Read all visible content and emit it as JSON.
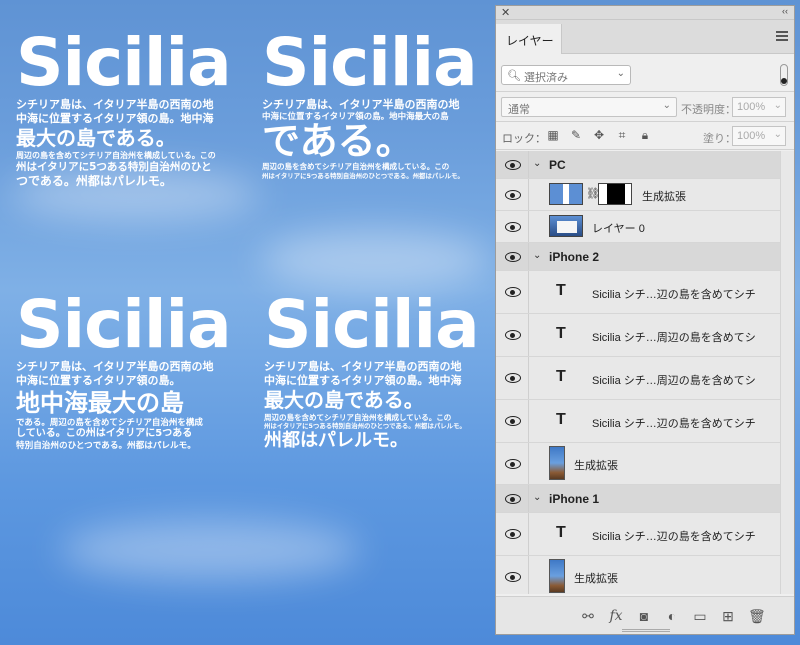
{
  "canvas": {
    "blocks": [
      {
        "title": "Sicilia",
        "lines": [
          "シチリア島は、イタリア半島の西南の地",
          "中海に位置するイタリア領の島。地中海",
          "最大の島である。",
          "周辺の島を含めてシチリア自治州を構成している。この",
          "州はイタリアに5つある特別自治州のひと",
          "つである。州都はパレルモ。"
        ]
      },
      {
        "title": "Sicilia",
        "lines": [
          "シチリア島は、イタリア半島の西南の地",
          "中海に位置するイタリア領の島。地中海最大の島",
          "である。",
          "周辺の島を含めてシチリア自治州を構成している。この",
          "州はイタリアに5つある特別自治州のひとつである。州都はパレルモ。"
        ]
      },
      {
        "title": "Sicilia",
        "lines": [
          "シチリア島は、イタリア半島の西南の地",
          "中海に位置するイタリア領の島。",
          "地中海最大の島",
          "である。周辺の島を含めてシチリア自治州を構成",
          "している。この州はイタリアに5つある",
          "特別自治州のひとつである。州都はパレルモ。"
        ]
      },
      {
        "title": "Sicilia",
        "lines": [
          "シチリア島は、イタリア半島の西南の地",
          "中海に位置するイタリア領の島。地中海",
          "最大の島である。",
          "周辺の島を含めてシチリア自治州を構成している。この",
          "州はイタリアに5つある特別自治州のひとつである。州都はパレルモ。",
          "州都はパレルモ。"
        ]
      }
    ]
  },
  "panel": {
    "tab_label": "レイヤー",
    "filter": {
      "value": "選択済み"
    },
    "blend_mode": "通常",
    "opacity_label": "不透明度：",
    "opacity_value": "100%",
    "lock_label": "ロック：",
    "fill_label": "塗り：",
    "fill_value": "100%",
    "rows": [
      {
        "kind": "group",
        "name": "PC"
      },
      {
        "kind": "smart",
        "name": "生成拡張"
      },
      {
        "kind": "image",
        "name": "レイヤー 0"
      },
      {
        "kind": "group",
        "name": "iPhone 2"
      },
      {
        "kind": "text",
        "name": "Sicilia シチ…辺の島を含めてシチ"
      },
      {
        "kind": "text",
        "name": "Sicilia シチ…周辺の島を含めてシ"
      },
      {
        "kind": "text",
        "name": "Sicilia シチ…周辺の島を含めてシ"
      },
      {
        "kind": "text",
        "name": "Sicilia シチ…辺の島を含めてシチ"
      },
      {
        "kind": "phone",
        "name": "生成拡張"
      },
      {
        "kind": "group",
        "name": "iPhone 1"
      },
      {
        "kind": "text",
        "name": "Sicilia シチ…辺の島を含めてシチ"
      },
      {
        "kind": "phone",
        "name": "生成拡張"
      }
    ],
    "bottom_icons": [
      "link-icon",
      "fx-icon",
      "mask-icon",
      "adjustment-icon",
      "folder-icon",
      "new-layer-icon",
      "trash-icon"
    ]
  }
}
